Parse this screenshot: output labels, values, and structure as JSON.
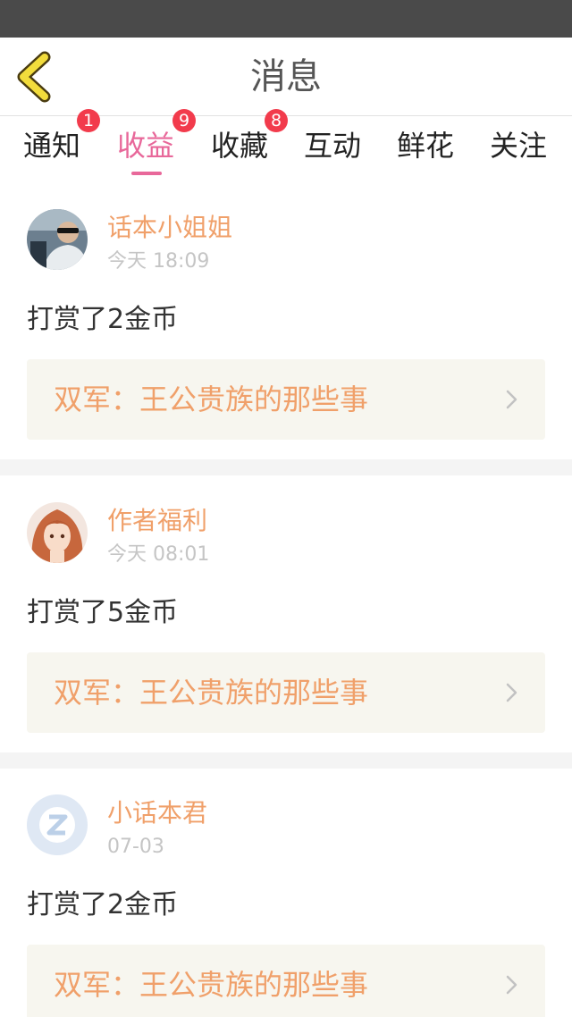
{
  "header": {
    "title": "消息",
    "back_icon": "chevron-left-icon"
  },
  "colors": {
    "accent_pink": "#e8689a",
    "username_orange": "#f0a06a",
    "badge_red": "#f23b4c",
    "back_icon_yellow": "#f2dc3c"
  },
  "tabs": [
    {
      "label": "通知",
      "badge": "1"
    },
    {
      "label": "收益",
      "badge": "9",
      "active": true
    },
    {
      "label": "收藏",
      "badge": "8"
    },
    {
      "label": "互动"
    },
    {
      "label": "鲜花"
    },
    {
      "label": "关注"
    }
  ],
  "messages": [
    {
      "user": "话本小姐姐",
      "time": "今天 18:09",
      "text": "打赏了2金币",
      "book": "双军：王公贵族的那些事",
      "avatar": "photo-avatar"
    },
    {
      "user": "作者福利",
      "time": "今天 08:01",
      "text": "打赏了5金币",
      "book": "双军：王公贵族的那些事",
      "avatar": "anime-girl-avatar"
    },
    {
      "user": "小话本君",
      "time": "07-03",
      "text": "打赏了2金币",
      "book": "双军：王公贵族的那些事",
      "avatar": "default-logo-avatar"
    }
  ]
}
